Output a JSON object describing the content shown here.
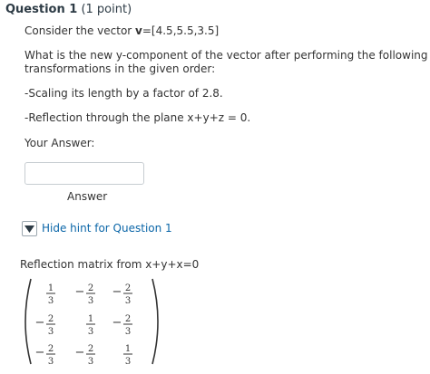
{
  "question": {
    "title": "Question 1",
    "points": "(1 point)",
    "line1_prefix": "Consider the vector ",
    "line1_vec": "v",
    "line1_suffix": "=[4.5,5.5,3.5]",
    "prompt_line1": "What is the new y-component of the vector after performing the following",
    "prompt_line2": "transformations in the given order:",
    "step1": "-Scaling its length by a factor of 2.8.",
    "step2": "-Reflection through the plane x+y+z = 0.",
    "your_answer_label": "Your Answer:",
    "answer_value": "",
    "answer_caption": "Answer"
  },
  "hint": {
    "toggle_icon": "triangle-down-icon",
    "link_label": "Hide hint for Question 1",
    "matrix_title": "Reflection matrix from x+y+x=0",
    "matrix": [
      [
        {
          "sign": "",
          "num": "1",
          "den": "3"
        },
        {
          "sign": "−",
          "num": "2",
          "den": "3"
        },
        {
          "sign": "−",
          "num": "2",
          "den": "3"
        }
      ],
      [
        {
          "sign": "−",
          "num": "2",
          "den": "3"
        },
        {
          "sign": "",
          "num": "1",
          "den": "3"
        },
        {
          "sign": "−",
          "num": "2",
          "den": "3"
        }
      ],
      [
        {
          "sign": "−",
          "num": "2",
          "den": "3"
        },
        {
          "sign": "−",
          "num": "2",
          "den": "3"
        },
        {
          "sign": "",
          "num": "1",
          "den": "3"
        }
      ]
    ]
  },
  "colors": {
    "link": "#0b66a8",
    "text": "#333333",
    "heading": "#2d3b45"
  }
}
